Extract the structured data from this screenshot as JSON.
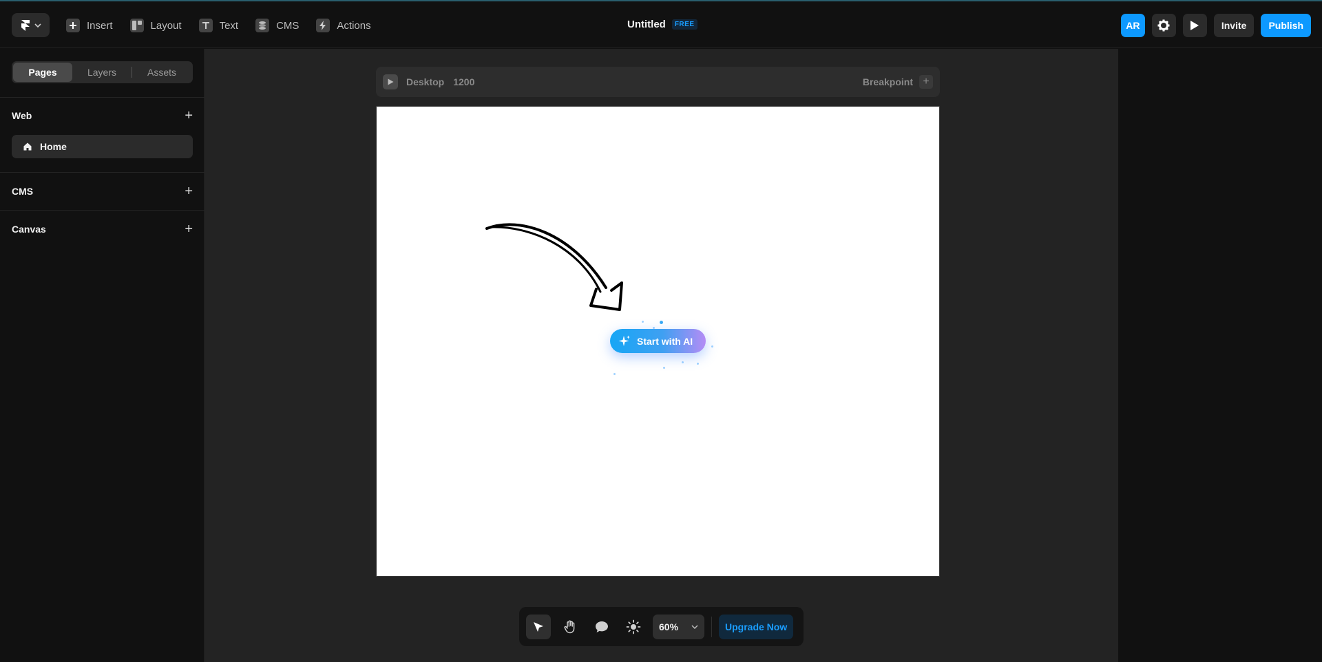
{
  "header": {
    "menu": [
      {
        "label": "Insert",
        "icon": "plus-square-icon"
      },
      {
        "label": "Layout",
        "icon": "layout-icon"
      },
      {
        "label": "Text",
        "icon": "text-icon"
      },
      {
        "label": "CMS",
        "icon": "database-icon"
      },
      {
        "label": "Actions",
        "icon": "lightning-icon"
      }
    ],
    "title": "Untitled",
    "plan_badge": "FREE",
    "avatar_initials": "AR",
    "invite_label": "Invite",
    "publish_label": "Publish"
  },
  "sidebar": {
    "tabs": [
      "Pages",
      "Layers",
      "Assets"
    ],
    "active_tab": "Pages",
    "sections": {
      "web": "Web",
      "cms": "CMS",
      "canvas": "Canvas"
    },
    "pages": [
      {
        "label": "Home",
        "icon": "home-icon"
      }
    ]
  },
  "canvas": {
    "frame_name": "Desktop",
    "frame_width": "1200",
    "breakpoint_label": "Breakpoint",
    "ai_button_label": "Start with AI"
  },
  "toolbar": {
    "zoom": "60%",
    "upgrade_label": "Upgrade Now"
  },
  "colors": {
    "accent": "#0d99ff",
    "background": "#111111",
    "canvas_bg": "#232323"
  }
}
